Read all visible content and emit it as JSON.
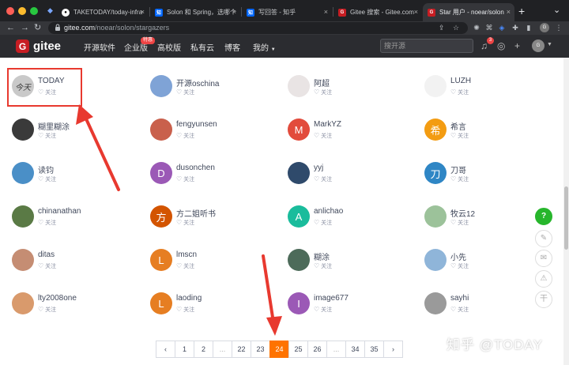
{
  "browser": {
    "tabs": [
      {
        "label": "TAKETODAY/today-infra",
        "favicon": "github-icon",
        "active": false
      },
      {
        "label": "Solon 和 Spring，选哪个",
        "favicon": "zhihu-icon",
        "active": false
      },
      {
        "label": "写回答 - 知乎",
        "favicon": "zhihu-icon",
        "active": false
      },
      {
        "label": "Gitee 搜索 - Gitee.com",
        "favicon": "gitee-icon",
        "active": false
      },
      {
        "label": "Star 用户 - noear/solon",
        "favicon": "gitee-icon",
        "active": true
      }
    ],
    "url_host": "gitee.com",
    "url_path": "/noear/solon/stargazers",
    "profile_initials": "G"
  },
  "header": {
    "logo_text": "gitee",
    "nav": [
      "开源软件",
      "企业版",
      "高校版",
      "私有云",
      "博客",
      "我的"
    ],
    "enterprise_badge": "特惠",
    "search_placeholder": "搜开源",
    "notification_count": "3",
    "user_initials": "G"
  },
  "follow_label": "关注",
  "users": [
    {
      "name": "TODAY",
      "avatar_text": "今天",
      "color": "#c9c9c9"
    },
    {
      "name": "开源oschina",
      "avatar_text": "",
      "color": "#7fa3d6"
    },
    {
      "name": "阿超",
      "avatar_text": "",
      "color": "#e9e4e4"
    },
    {
      "name": "LUZH",
      "avatar_text": "",
      "color": "#f2f2f2"
    },
    {
      "name": "糊里糊涂",
      "avatar_text": "",
      "color": "#3a3a3a"
    },
    {
      "name": "fengyunsen",
      "avatar_text": "",
      "color": "#c9604c"
    },
    {
      "name": "MarkYZ",
      "avatar_text": "M",
      "color": "#e24b3c"
    },
    {
      "name": "希言",
      "avatar_text": "希",
      "color": "#f39c12"
    },
    {
      "name": "读钧",
      "avatar_text": "",
      "color": "#4a8fc7"
    },
    {
      "name": "dusonchen",
      "avatar_text": "D",
      "color": "#9b59b6"
    },
    {
      "name": "yyj",
      "avatar_text": "",
      "color": "#2f4a6b"
    },
    {
      "name": "刀哥",
      "avatar_text": "刀",
      "color": "#2f86c5"
    },
    {
      "name": "chinanathan",
      "avatar_text": "",
      "color": "#5a7a45"
    },
    {
      "name": "方二姐听书",
      "avatar_text": "方",
      "color": "#d35400"
    },
    {
      "name": "anlichao",
      "avatar_text": "A",
      "color": "#1abc9c"
    },
    {
      "name": "牧云12",
      "avatar_text": "",
      "color": "#9cc29a"
    },
    {
      "name": "ditas",
      "avatar_text": "",
      "color": "#c58d73"
    },
    {
      "name": "lmscn",
      "avatar_text": "L",
      "color": "#e67e22"
    },
    {
      "name": "糊涂",
      "avatar_text": "",
      "color": "#4d6b5a"
    },
    {
      "name": "小先",
      "avatar_text": "",
      "color": "#8fb5d9"
    },
    {
      "name": "lty2008one",
      "avatar_text": "",
      "color": "#d99a6c"
    },
    {
      "name": "laoding",
      "avatar_text": "L",
      "color": "#e67e22"
    },
    {
      "name": "image677",
      "avatar_text": "I",
      "color": "#9b59b6"
    },
    {
      "name": "sayhi",
      "avatar_text": "",
      "color": "#9a9a9a"
    }
  ],
  "pagination": {
    "prev": "‹",
    "next": "›",
    "pages": [
      "1",
      "2",
      "...",
      "22",
      "23",
      "24",
      "25",
      "26",
      "...",
      "34",
      "35"
    ],
    "current": "24"
  },
  "sidebar_tools": [
    {
      "icon": "help-icon",
      "glyph": "?"
    },
    {
      "icon": "edit-icon",
      "glyph": "✎"
    },
    {
      "icon": "mail-icon",
      "glyph": "✉"
    },
    {
      "icon": "warning-icon",
      "glyph": "⚠"
    },
    {
      "icon": "top-icon",
      "glyph": "干"
    }
  ],
  "watermark": "知乎 @TODAY",
  "colors": {
    "accent": "#fe7300",
    "annotation": "#e8392f",
    "brand": "#c71d23"
  }
}
